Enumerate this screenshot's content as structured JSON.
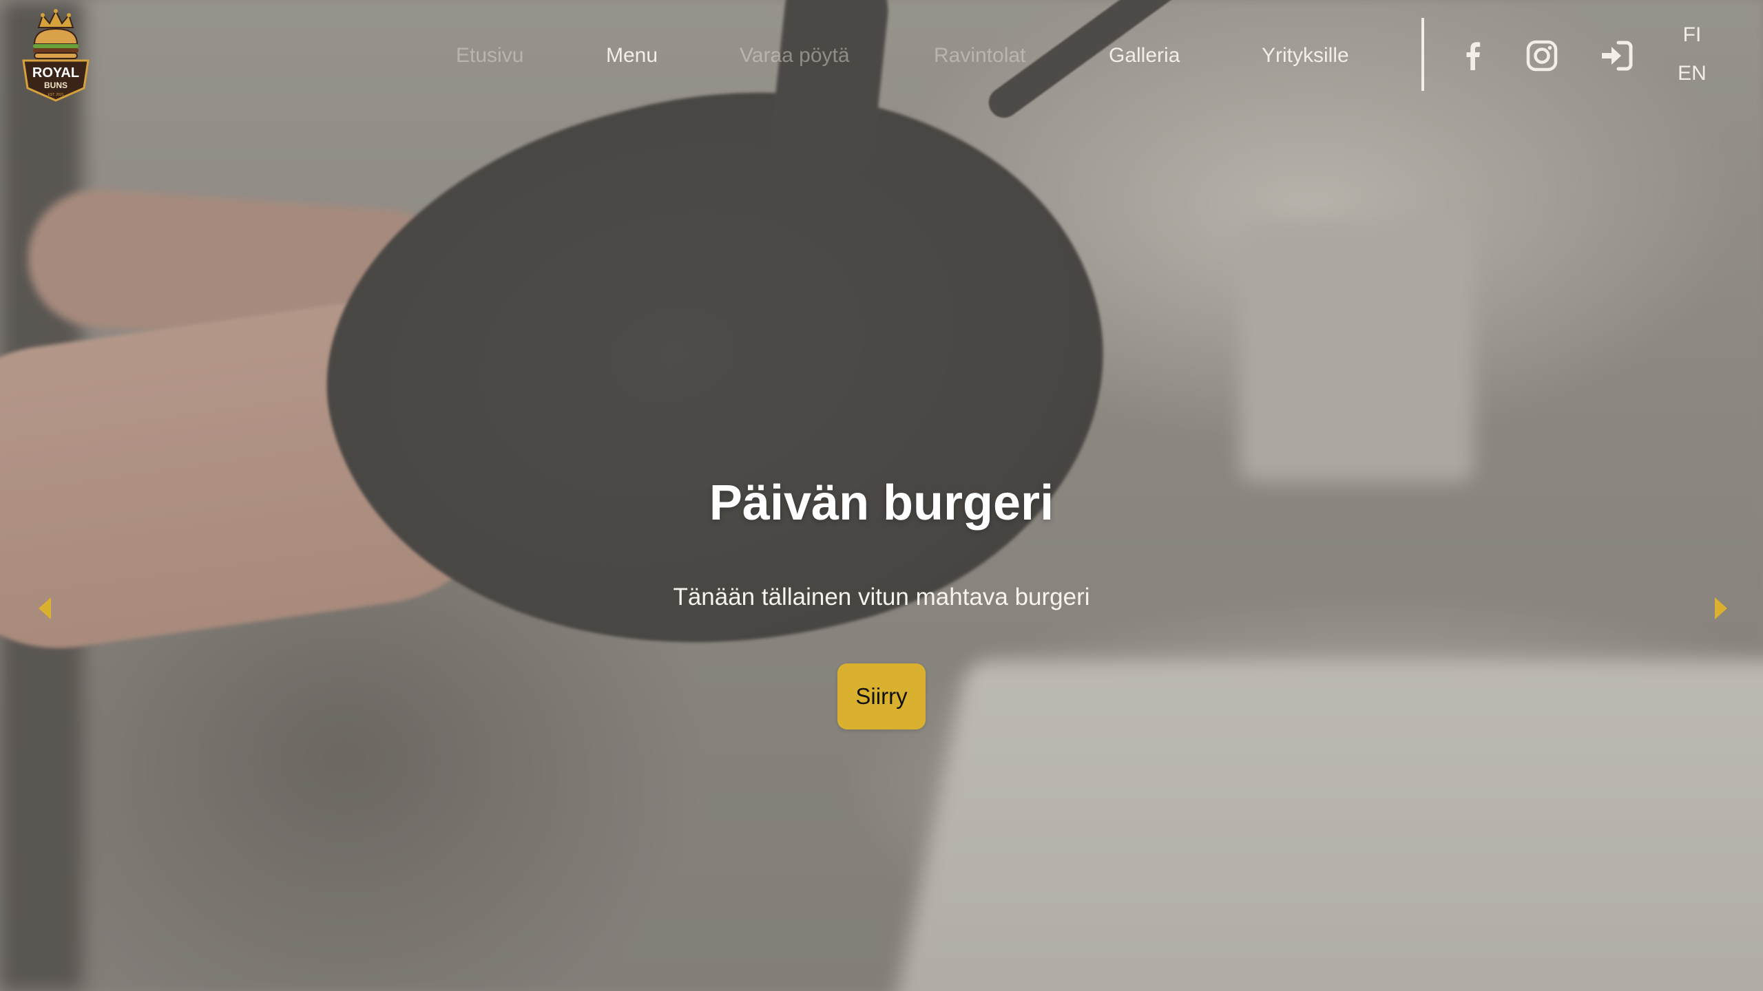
{
  "brand": {
    "logo_top_text": "ROYAL",
    "logo_bottom_text": "BUNS",
    "logo_small_text": "EST. 2021",
    "colors": {
      "gold": "#d9b12e",
      "logo_dark": "#3a2418",
      "logo_gold": "#d6a23c"
    }
  },
  "nav": {
    "items": [
      {
        "label": "Etusivu",
        "state": "faded"
      },
      {
        "label": "Menu",
        "state": "bright"
      },
      {
        "label": "Varaa pöytä",
        "state": "faded"
      },
      {
        "label": "Ravintolat",
        "state": "faded"
      },
      {
        "label": "Galleria",
        "state": "bright"
      },
      {
        "label": "Yrityksille",
        "state": "bright"
      }
    ]
  },
  "social": {
    "icons": [
      "facebook-icon",
      "instagram-icon",
      "login-icon"
    ]
  },
  "language": {
    "options": [
      "FI",
      "EN"
    ]
  },
  "hero": {
    "title": "Päivän burgeri",
    "subtitle": "Tänään tällainen vitun mahtava burgeri",
    "button_label": "Siirry",
    "arrow_color": "#d9b12e"
  }
}
